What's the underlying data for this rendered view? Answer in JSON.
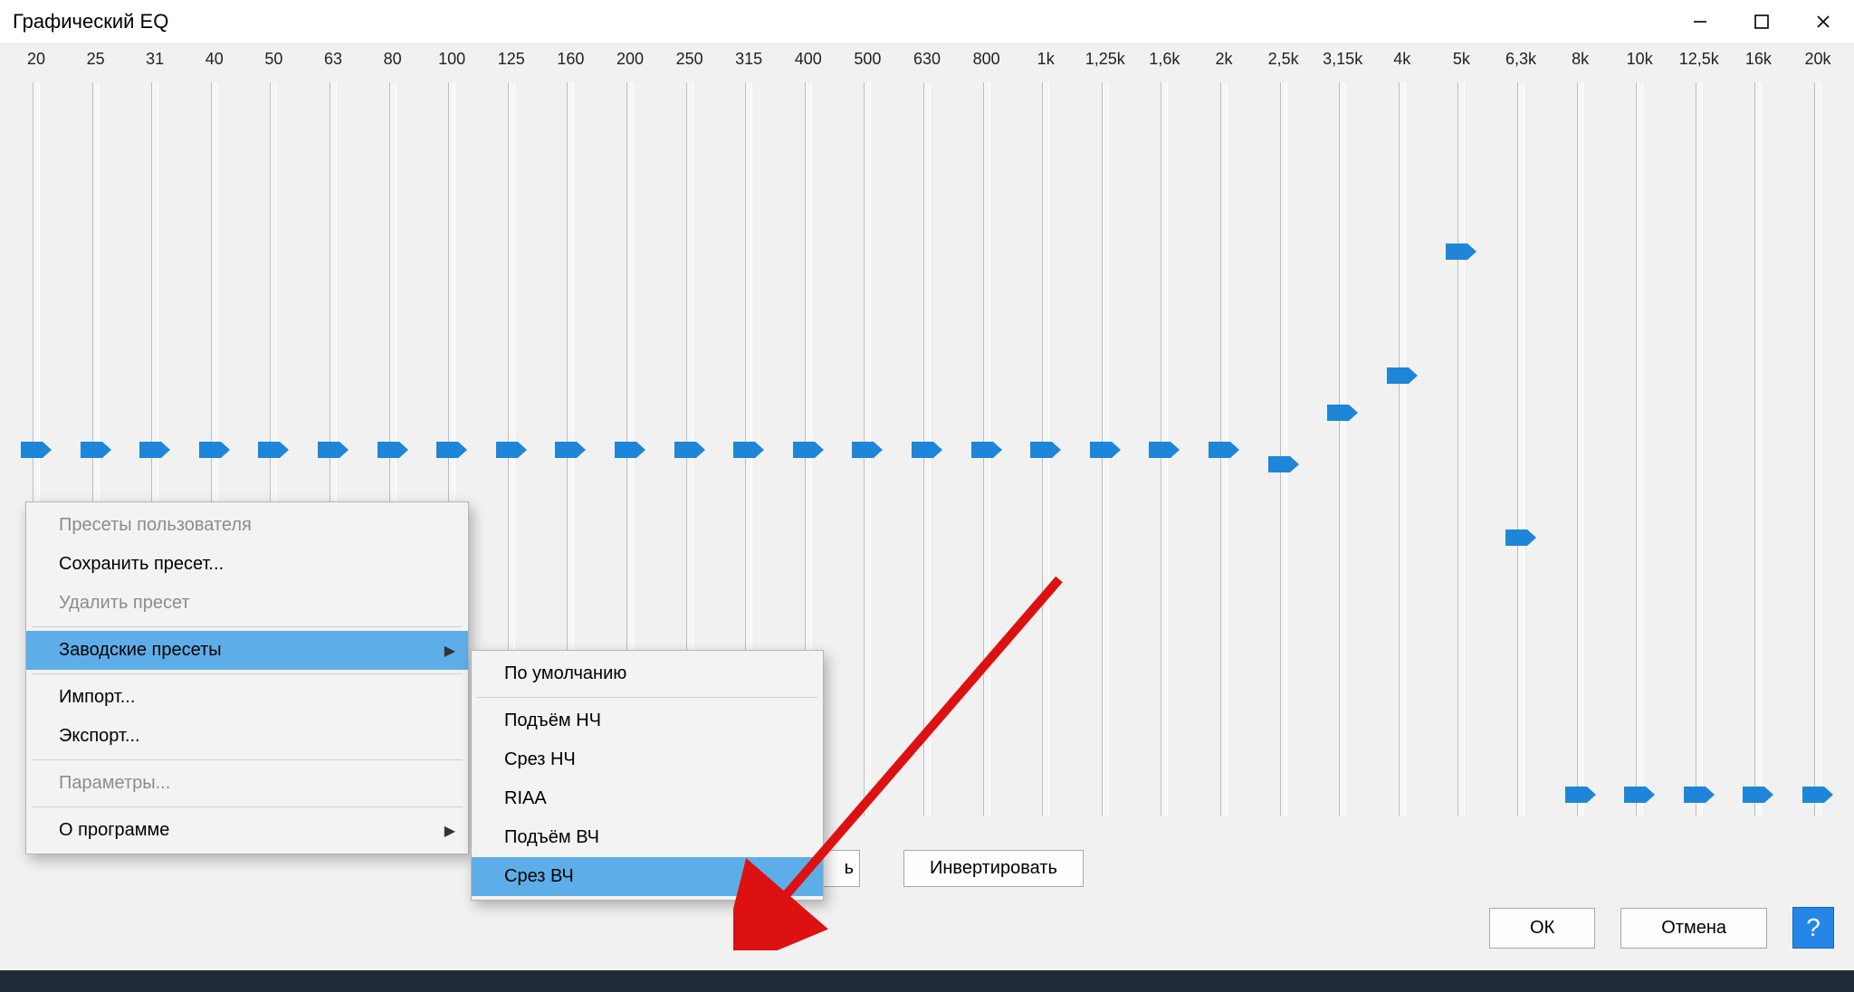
{
  "window": {
    "title": "Графический EQ"
  },
  "frequencies": [
    "20",
    "25",
    "31",
    "40",
    "50",
    "63",
    "80",
    "100",
    "125",
    "160",
    "200",
    "250",
    "315",
    "400",
    "500",
    "630",
    "800",
    "1k",
    "1,25k",
    "1,6k",
    "2k",
    "2,5k",
    "3,15k",
    "4k",
    "5k",
    "6,3k",
    "8k",
    "10k",
    "12,5k",
    "16k",
    "20k"
  ],
  "slider_values_pct": [
    50,
    50,
    50,
    50,
    50,
    50,
    50,
    50,
    50,
    50,
    50,
    50,
    50,
    50,
    50,
    50,
    50,
    50,
    50,
    50,
    50,
    52,
    45,
    40,
    23,
    62,
    97,
    97,
    97,
    97,
    97
  ],
  "buttons": {
    "invert": "Инвертировать",
    "partial_hidden": "ь",
    "ok": "ОК",
    "cancel": "Отмена",
    "help": "?"
  },
  "menu_main": {
    "user_presets_header": "Пресеты пользователя",
    "save_preset": "Сохранить пресет...",
    "delete_preset": "Удалить пресет",
    "factory_presets": "Заводские пресеты",
    "import": "Импорт...",
    "export": "Экспорт...",
    "options": "Параметры...",
    "about": "О программе"
  },
  "menu_factory": {
    "default": "По умолчанию",
    "bass_boost": "Подъём НЧ",
    "bass_cut": "Срез НЧ",
    "riaa": "RIAA",
    "treble_boost": "Подъём ВЧ",
    "treble_cut": "Срез ВЧ"
  }
}
